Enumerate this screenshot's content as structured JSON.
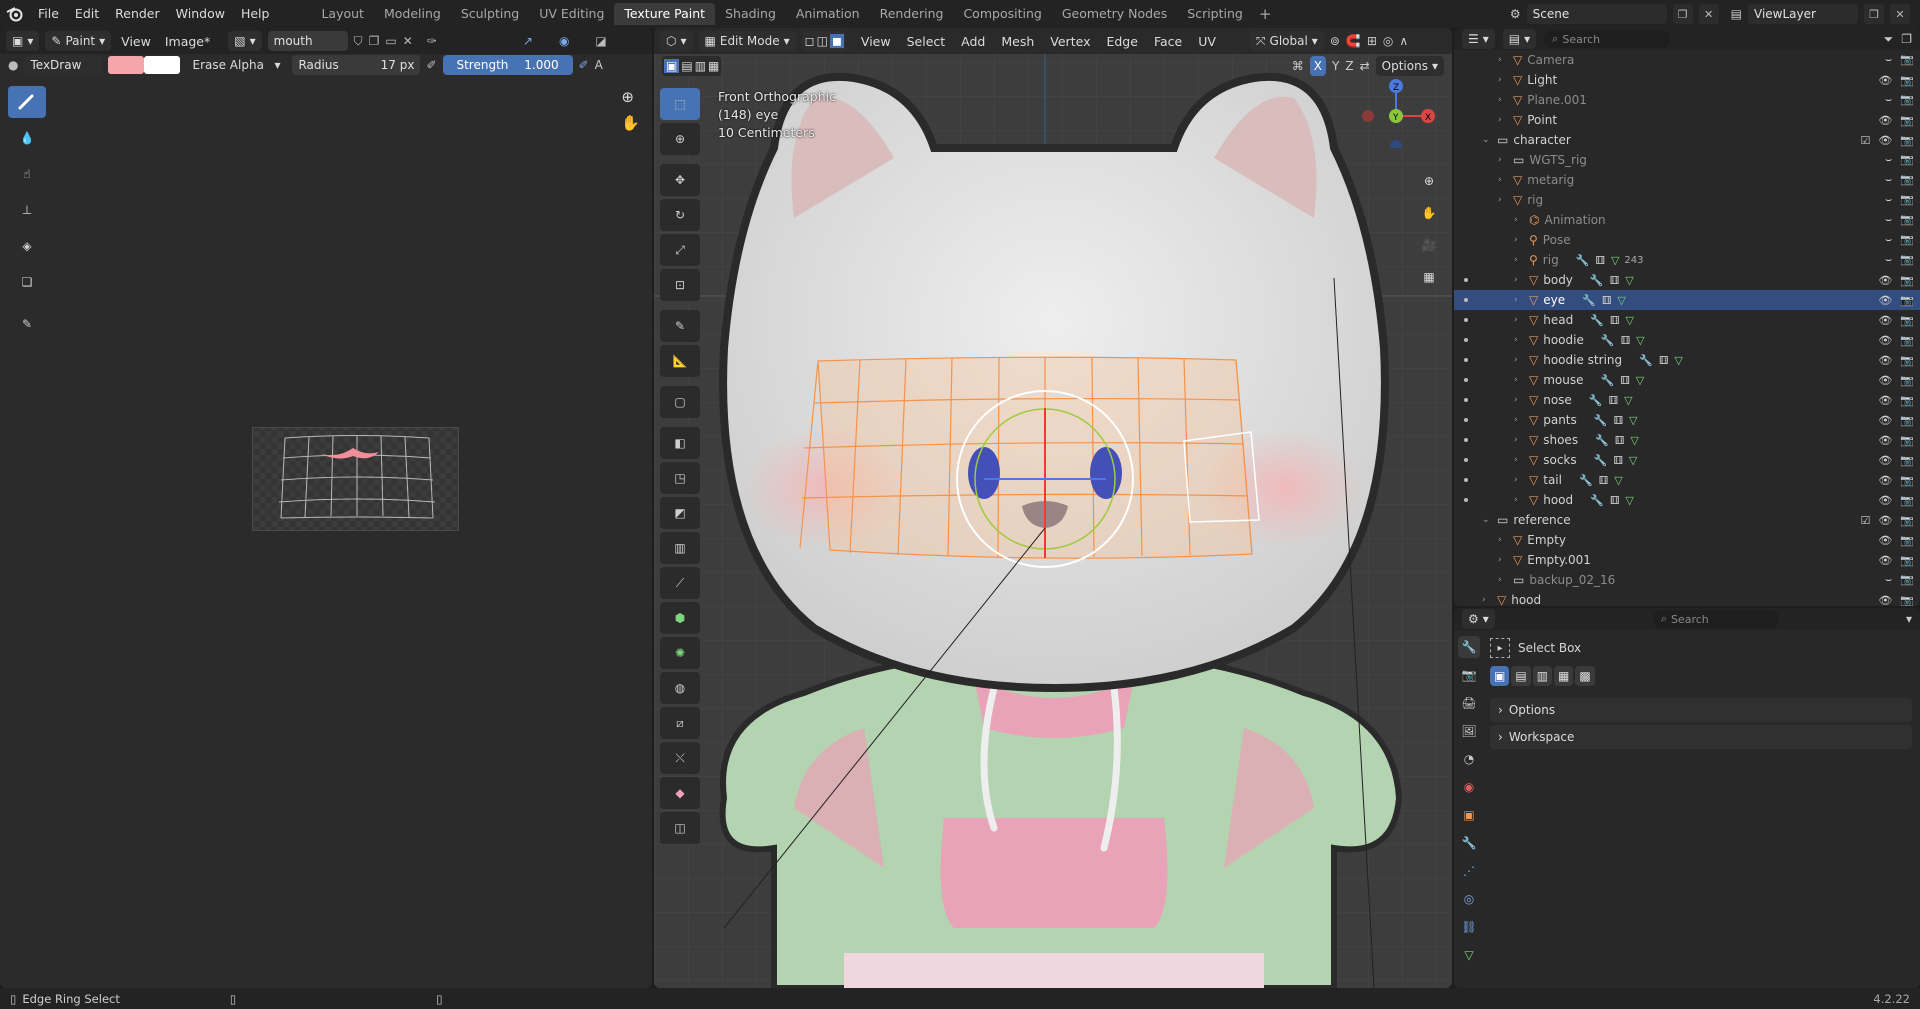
{
  "topbar": {
    "menus": [
      "File",
      "Edit",
      "Render",
      "Window",
      "Help"
    ],
    "workspaces": [
      "Layout",
      "Modeling",
      "Sculpting",
      "UV Editing",
      "Texture Paint",
      "Shading",
      "Animation",
      "Rendering",
      "Compositing",
      "Geometry Nodes",
      "Scripting"
    ],
    "active_workspace": "Texture Paint",
    "add_symbol": "+",
    "scene": "Scene",
    "view_layer": "ViewLayer"
  },
  "image_editor": {
    "mode": "Paint",
    "menus": [
      "View",
      "Image*"
    ],
    "image_name": "mouth",
    "brush": "TexDraw",
    "primary_color": "#f4a6aa",
    "secondary_color": "#ffffff",
    "blend": "Erase Alpha",
    "radius_label": "Radius",
    "radius_value": "17 px",
    "strength_label": "Strength",
    "strength_value": "1.000",
    "extra_letter": "A"
  },
  "viewport": {
    "mode": "Edit Mode",
    "menus": [
      "View",
      "Select",
      "Add",
      "Mesh",
      "Vertex",
      "Edge",
      "Face",
      "UV"
    ],
    "orientation": "Global",
    "options_label": "Options",
    "axes": [
      "X",
      "Y",
      "Z"
    ],
    "overlay_lines": [
      "Front Orthographic",
      "(148) eye",
      "10 Centimeters"
    ]
  },
  "outliner": {
    "search_placeholder": "Search",
    "rows": [
      {
        "name": "Camera",
        "depth": 2,
        "type": "obj",
        "dim": true
      },
      {
        "name": "Light",
        "depth": 2,
        "type": "obj"
      },
      {
        "name": "Plane.001",
        "depth": 2,
        "type": "obj",
        "dim": true
      },
      {
        "name": "Point",
        "depth": 2,
        "type": "obj"
      },
      {
        "name": "character",
        "depth": 1,
        "type": "col"
      },
      {
        "name": "WGTS_rig",
        "depth": 2,
        "type": "col",
        "dim": true
      },
      {
        "name": "metarig",
        "depth": 2,
        "type": "obj",
        "dim": true
      },
      {
        "name": "rig",
        "depth": 2,
        "type": "obj",
        "dim": true
      },
      {
        "name": "Animation",
        "depth": 3,
        "type": "anim",
        "dim": true
      },
      {
        "name": "Pose",
        "depth": 3,
        "type": "pose",
        "dim": true
      },
      {
        "name": "rig",
        "depth": 3,
        "type": "arm",
        "dim": true,
        "badge": "243"
      },
      {
        "name": "body",
        "depth": 3,
        "type": "mesh"
      },
      {
        "name": "eye",
        "depth": 3,
        "type": "mesh",
        "selected": true
      },
      {
        "name": "head",
        "depth": 3,
        "type": "mesh"
      },
      {
        "name": "hoodie",
        "depth": 3,
        "type": "mesh"
      },
      {
        "name": "hoodie string",
        "depth": 3,
        "type": "mesh"
      },
      {
        "name": "mouse",
        "depth": 3,
        "type": "mesh"
      },
      {
        "name": "nose",
        "depth": 3,
        "type": "mesh"
      },
      {
        "name": "pants",
        "depth": 3,
        "type": "mesh"
      },
      {
        "name": "shoes",
        "depth": 3,
        "type": "mesh"
      },
      {
        "name": "socks",
        "depth": 3,
        "type": "mesh"
      },
      {
        "name": "tail",
        "depth": 3,
        "type": "mesh"
      },
      {
        "name": "hood",
        "depth": 3,
        "type": "mesh"
      },
      {
        "name": "reference",
        "depth": 1,
        "type": "col"
      },
      {
        "name": "Empty",
        "depth": 2,
        "type": "obj"
      },
      {
        "name": "Empty.001",
        "depth": 2,
        "type": "obj"
      },
      {
        "name": "backup_02_16",
        "depth": 2,
        "type": "col",
        "dim": true
      },
      {
        "name": "hood",
        "depth": 1,
        "type": "obj"
      }
    ]
  },
  "properties": {
    "search_placeholder": "Search",
    "tool_name": "Select Box",
    "panels": [
      "Options",
      "Workspace"
    ]
  },
  "statusbar": {
    "left_text": "Edge Ring Select",
    "version": "4.2.22"
  },
  "colors": {
    "accent": "#4772b3",
    "selected_row": "#334d80",
    "mesh_orange": "#f5934a",
    "hoodie_green": "#b7d8b5",
    "pink": "#e8a3b0"
  }
}
